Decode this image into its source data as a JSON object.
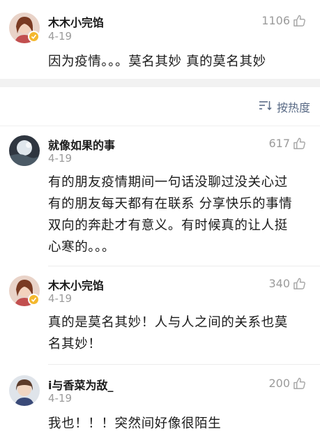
{
  "comments_top": [
    {
      "username": "木木小完馅",
      "date": "4-19",
      "likes": "1106",
      "text": "因为疫情。。。莫名其妙 真的莫名其妙"
    }
  ],
  "sort": {
    "label": "按热度"
  },
  "comments": [
    {
      "username": "就像如果的事",
      "date": "4-19",
      "likes": "617",
      "lines": [
        "有的朋友疫情期间一句话没聊过没关心过",
        "有的朋友每天都有在联系 分享快乐的事情",
        "双向的奔赴才有意义。有时候真的让人挺",
        "心寒的。。。"
      ]
    },
    {
      "username": "木木小完馅",
      "date": "4-19",
      "likes": "340",
      "lines": [
        "真的是莫名其妙！人与人之间的关系也莫",
        "名其妙！"
      ]
    },
    {
      "username": "i与香菜为敌_",
      "date": "4-19",
      "likes": "200",
      "lines": [
        "我也！！！突然间好像很陌生"
      ]
    }
  ],
  "icons": {
    "like": "thumbs-up-icon",
    "sort": "sort-lines-icon",
    "verified": "verified-badge-icon"
  },
  "colors": {
    "accent_link": "#5a6b86",
    "badge": "#f4b82e",
    "muted": "#9b9b9b"
  }
}
